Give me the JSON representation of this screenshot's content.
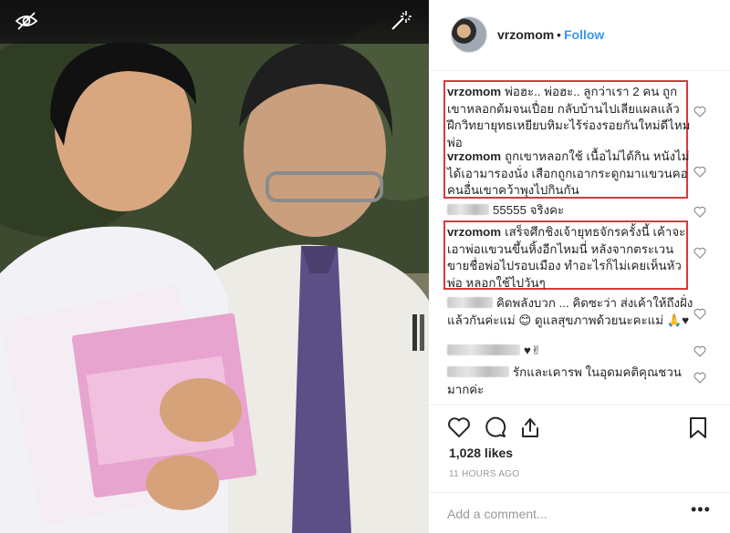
{
  "photo": {
    "hide_icon": "eye-slash-icon",
    "magic_icon": "magic-wand-icon"
  },
  "post": {
    "username": "vrzomom",
    "separator": "•",
    "follow_label": "Follow"
  },
  "comments": [
    {
      "user": "vrzomom",
      "text": "พ่อฮะ.. พ่อฮะ.. ลูกว่าเรา 2 คน ถูกเขาหลอกต้มจนเปื่อย กลับบ้านไปเลียแผลแล้วฝึกวิทยายุทธเหยียบหิมะไร้ร่องรอยกันใหม่ดีไหมพ่อ",
      "highlighted": true
    },
    {
      "user": "vrzomom",
      "text": "ถูกเขาหลอกใช้ เนื้อไม่ได้กิน หนังไม่ได้เอามารองนั่ง เสือกถูกเอากระดูกมาแขวนคอ คนอื่นเขาคว้าพุงไปกินกัน",
      "highlighted": true
    },
    {
      "user": "",
      "text": "55555 จริงคะ",
      "highlighted": false
    },
    {
      "user": "vrzomom",
      "text": "เสร็จศึกชิงเจ้ายุทธจักรครั้งนี้ เค้าจะเอาพ่อแขวนขึ้นหิ้งอีกไหมนี่ หลังจากตระเวนขายชื่อพ่อไปรอบเมือง ทำอะไรก็ไม่เคยเห็นหัวพ่อ หลอกใช้ไปวันๆ",
      "highlighted": true
    },
    {
      "user": "",
      "text": "คิดพลังบวก ... คิดซะว่า ส่งเค้าให้ถึงฝั่ง แล้วกันค่ะแม่ 😊 ดูแลสุขภาพด้วยนะคะแม่ 🙏♥",
      "highlighted": false
    },
    {
      "user": "",
      "text": "♥✌",
      "highlighted": false
    },
    {
      "user": "",
      "text": "รักและเคารพ ในอุดมคติคุณชวนมากค่ะ",
      "highlighted": false
    }
  ],
  "actions": {
    "like_icon": "heart-outline-icon",
    "comment_icon": "comment-bubble-icon",
    "share_icon": "share-icon",
    "save_icon": "bookmark-icon",
    "likes": "1,028 likes",
    "timestamp": "11 HOURS AGO",
    "add_comment_placeholder": "Add a comment...",
    "more_label": "•••"
  },
  "colors": {
    "follow": "#3897f0",
    "highlight_box": "#d63a3a",
    "muted": "#999999"
  }
}
